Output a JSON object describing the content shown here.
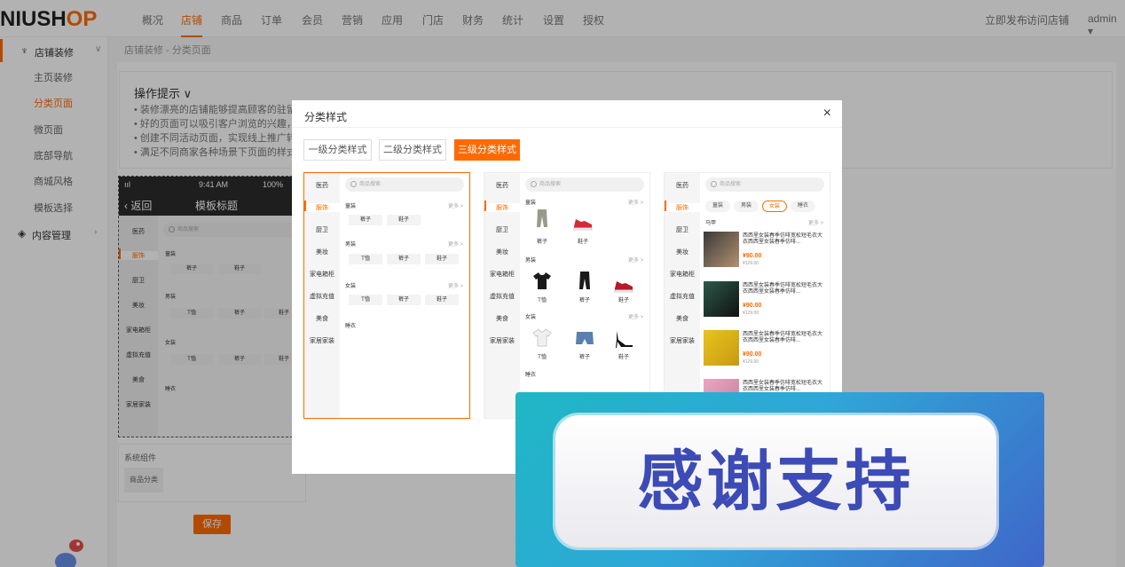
{
  "logo": {
    "part1": "NIUSH",
    "part2": "OP"
  },
  "nav": {
    "items": [
      "概况",
      "店铺",
      "商品",
      "订单",
      "会员",
      "营销",
      "应用",
      "门店",
      "财务",
      "统计",
      "设置",
      "授权"
    ],
    "active": "店铺",
    "publish": "立即发布",
    "visit": "访问店铺",
    "user": "admin"
  },
  "sidebar": {
    "group1": "店铺装修",
    "items": [
      "主页装修",
      "分类页面",
      "微页面",
      "底部导航",
      "商城风格",
      "模板选择"
    ],
    "active": "分类页面",
    "group2": "内容管理"
  },
  "breadcrumb": "店铺装修 - 分类页面",
  "tips": {
    "title": "操作提示",
    "lines": [
      "装修漂亮的店铺能够提高顾客的驻留时间",
      "好的页面可以吸引客户浏览的兴趣，快速",
      "创建不同活动页面，实现线上推广转化。",
      "满足不同商家各种场景下页面的样式及拓"
    ]
  },
  "phone": {
    "time": "9:41 AM",
    "battery": "100%",
    "signal": "ııl",
    "back": "返回",
    "title": "模板标题",
    "cats": [
      "医药",
      "服饰",
      "厨卫",
      "美妆",
      "家电箱柜",
      "虚拟充值",
      "美食",
      "家居家装"
    ],
    "search": "商品搜索",
    "sections": [
      {
        "title": "童装",
        "tags": [
          "裤子",
          "鞋子"
        ]
      },
      {
        "title": "男装",
        "tags": [
          "T恤",
          "裤子",
          "鞋子"
        ]
      },
      {
        "title": "女装",
        "tags": [
          "T恤",
          "裤子",
          "鞋子"
        ]
      },
      {
        "title": "睡衣",
        "tags": []
      }
    ]
  },
  "system": {
    "label": "系统组件",
    "component": "商品分类"
  },
  "save": "保存",
  "modal": {
    "title": "分类样式",
    "close": "×",
    "tabs": [
      "一级分类样式",
      "二级分类样式",
      "三级分类样式"
    ],
    "active_tab": "三级分类样式"
  },
  "pv": {
    "cats": [
      "医药",
      "服饰",
      "厨卫",
      "美妆",
      "家电箱柜",
      "虚拟充值",
      "美食",
      "家居家装"
    ],
    "search": "商品搜索",
    "more": "更多 >",
    "p1": [
      {
        "title": "童装",
        "tags": [
          "裤子",
          "鞋子"
        ]
      },
      {
        "title": "男装",
        "tags": [
          "T恤",
          "裤子",
          "鞋子"
        ]
      },
      {
        "title": "女装",
        "tags": [
          "T恤",
          "裤子",
          "鞋子"
        ]
      },
      {
        "title": "睡衣",
        "tags": []
      }
    ],
    "p2": [
      {
        "title": "童装",
        "items": [
          "裤子",
          "鞋子"
        ]
      },
      {
        "title": "男装",
        "items": [
          "T恤",
          "裤子",
          "鞋子"
        ]
      },
      {
        "title": "女装",
        "items": [
          "T恤",
          "裤子",
          "鞋子"
        ]
      },
      {
        "title": "睡衣",
        "items": []
      }
    ],
    "p3": {
      "chips": [
        "童装",
        "男装",
        "女装",
        "睡衣"
      ],
      "active_chip": "女装",
      "section": "马甲",
      "products": [
        {
          "name": "西西里女装春季仿啡宽松短毛衣大衣西西里女装春季仿啡...",
          "price": "¥90.00",
          "old": "¥129.00"
        },
        {
          "name": "西西里女装春季仿啡宽松短毛衣大衣西西里女装春季仿啡...",
          "price": "¥90.00",
          "old": "¥129.00"
        },
        {
          "name": "西西里女装春季仿啡宽松短毛衣大衣西西里女装春季仿啡...",
          "price": "¥90.00",
          "old": "¥129.00"
        },
        {
          "name": "西西里女装春季仿啡宽松短毛衣大衣西西里女装春季仿啡...",
          "price": "",
          "old": ""
        }
      ]
    }
  },
  "banner": {
    "text": "感谢支持"
  },
  "colors": {
    "accent": "#ff6a00",
    "banner_text": "#3c4bb5"
  }
}
